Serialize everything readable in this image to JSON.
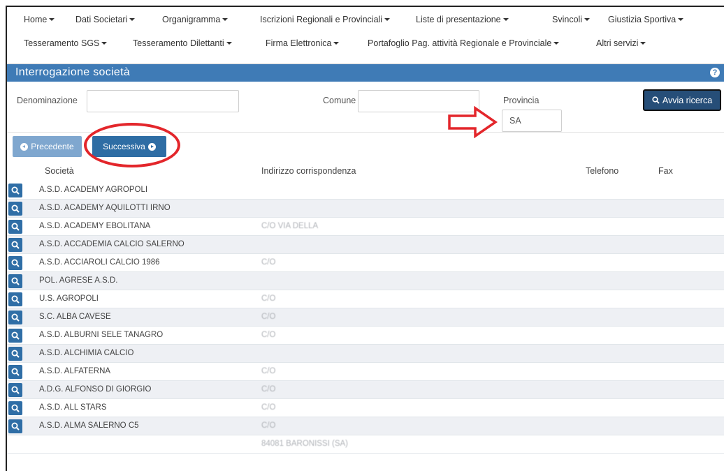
{
  "nav": {
    "row1": [
      {
        "label": "Home",
        "dropdown": true
      },
      {
        "label": "Dati Societari",
        "dropdown": true
      },
      {
        "label": "Organigramma",
        "dropdown": true
      },
      {
        "label": "Iscrizioni Regionali e Provinciali",
        "dropdown": true
      },
      {
        "label": "Liste di presentazione",
        "dropdown": true
      },
      {
        "label": "Svincoli",
        "dropdown": true
      },
      {
        "label": "Giustizia Sportiva",
        "dropdown": true
      }
    ],
    "row2": [
      {
        "label": "Tesseramento SGS",
        "dropdown": true
      },
      {
        "label": "Tesseramento Dilettanti",
        "dropdown": true
      },
      {
        "label": "Firma Elettronica",
        "dropdown": true
      },
      {
        "label": "Portafoglio Pag. attività Regionale e Provinciale",
        "dropdown": true
      },
      {
        "label": "Altri servizi",
        "dropdown": true
      }
    ]
  },
  "page": {
    "title": "Interrogazione società",
    "help_icon": "?"
  },
  "filters": {
    "denominazione_label": "Denominazione",
    "denominazione_value": "",
    "comune_label": "Comune",
    "comune_value": "",
    "provincia_label": "Provincia",
    "provincia_value": "SA",
    "search_button": "Avvia ricerca"
  },
  "pager": {
    "prev_label": "Precedente",
    "next_label": "Successiva"
  },
  "table": {
    "columns": [
      "Società",
      "Indirizzo corrispondenza",
      "Telefono",
      "Fax"
    ],
    "rows": [
      {
        "societa": "A.S.D. ACADEMY AGROPOLI",
        "indirizzo": "",
        "telefono": "",
        "fax": ""
      },
      {
        "societa": "A.S.D. ACADEMY AQUILOTTI IRNO",
        "indirizzo": "",
        "telefono": "",
        "fax": ""
      },
      {
        "societa": "A.S.D. ACADEMY EBOLITANA",
        "indirizzo": "C/O VIA DELLA",
        "telefono": "",
        "fax": ""
      },
      {
        "societa": "A.S.D. ACCADEMIA CALCIO SALERNO",
        "indirizzo": "",
        "telefono": "",
        "fax": ""
      },
      {
        "societa": "A.S.D. ACCIAROLI CALCIO 1986",
        "indirizzo": "C/O",
        "telefono": "",
        "fax": ""
      },
      {
        "societa": "POL. AGRESE A.S.D.",
        "indirizzo": "",
        "telefono": "",
        "fax": ""
      },
      {
        "societa": "U.S. AGROPOLI",
        "indirizzo": "C/O",
        "telefono": "",
        "fax": ""
      },
      {
        "societa": "S.C. ALBA CAVESE",
        "indirizzo": "C/O",
        "telefono": "",
        "fax": ""
      },
      {
        "societa": "A.S.D. ALBURNI SELE TANAGRO",
        "indirizzo": "C/O",
        "telefono": "",
        "fax": ""
      },
      {
        "societa": "A.S.D. ALCHIMIA CALCIO",
        "indirizzo": "",
        "telefono": "",
        "fax": ""
      },
      {
        "societa": "A.S.D. ALFATERNA",
        "indirizzo": "C/O",
        "telefono": "",
        "fax": ""
      },
      {
        "societa": "A.D.G. ALFONSO DI GIORGIO",
        "indirizzo": "C/O",
        "telefono": "",
        "fax": ""
      },
      {
        "societa": "A.S.D. ALL STARS",
        "indirizzo": "C/O",
        "telefono": "",
        "fax": ""
      },
      {
        "societa": "A.S.D. ALMA SALERNO C5",
        "indirizzo": "C/O",
        "telefono": "",
        "fax": ""
      },
      {
        "societa": "",
        "indirizzo": "84081 BARONISSI (SA)",
        "telefono": "",
        "fax": ""
      }
    ]
  },
  "colors": {
    "title_bar": "#3f7bb6",
    "button_primary": "#2e6da4",
    "button_disabled": "#7fa7cf",
    "search_button": "#264e78",
    "annotation_red": "#e3262b"
  }
}
